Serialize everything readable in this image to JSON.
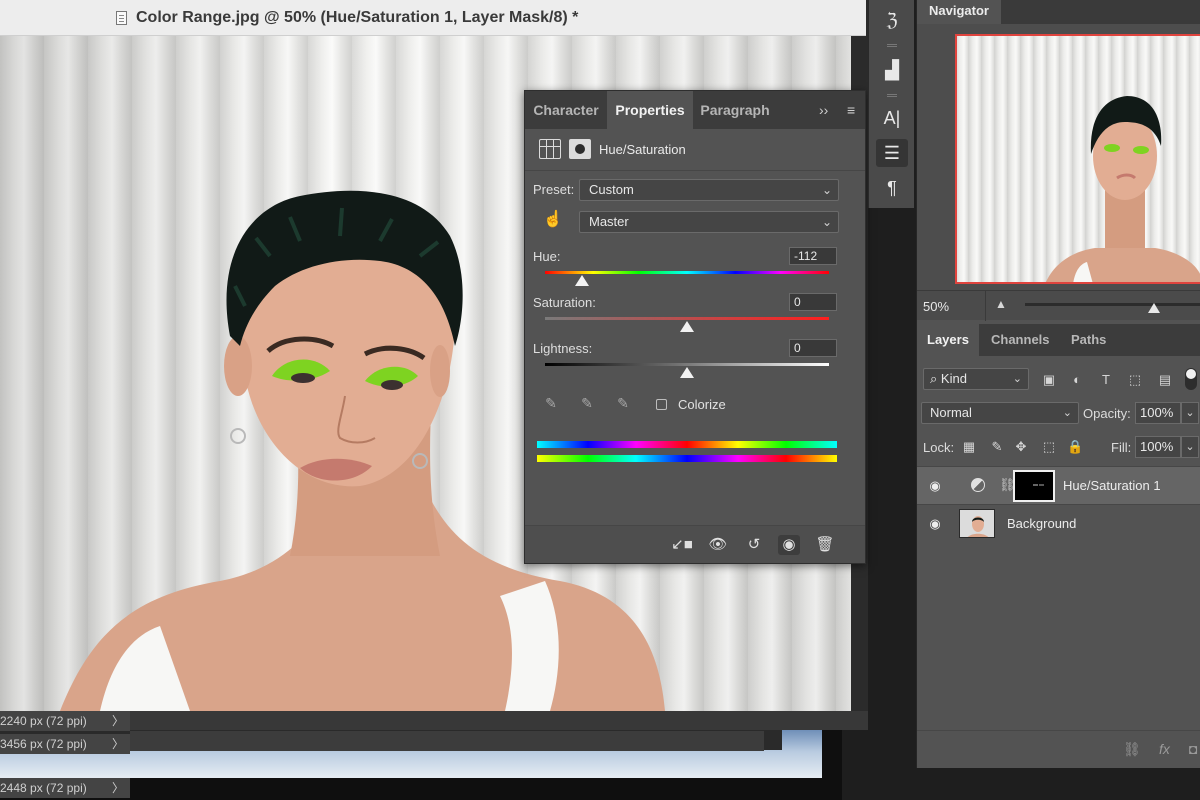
{
  "document": {
    "title": "Color Range.jpg @ 50% (Hue/Saturation 1, Layer Mask/8) *",
    "status_rows": [
      {
        "text": "2240 px (72 ppi)"
      },
      {
        "text": "3456 px (72 ppi)"
      },
      {
        "text": "2448 px (72 ppi)"
      }
    ]
  },
  "properties": {
    "tabs": [
      "Character",
      "Properties",
      "Paragraph"
    ],
    "active_tab": "Properties",
    "header_label": "Hue/Saturation",
    "preset_label": "Preset:",
    "preset_value": "Custom",
    "channel_value": "Master",
    "hue": {
      "label": "Hue:",
      "value": "-112",
      "position": 0.13
    },
    "saturation": {
      "label": "Saturation:",
      "value": "0",
      "position": 0.5
    },
    "lightness": {
      "label": "Lightness:",
      "value": "0",
      "position": 0.5
    },
    "colorize_label": "Colorize",
    "colorize_checked": false
  },
  "toolstrip": {
    "icons": [
      "history-brush-icon",
      "histogram-icon",
      "character-icon",
      "adjustments-icon",
      "paragraph-icon"
    ],
    "active": "adjustments-icon"
  },
  "navigator": {
    "tab": "Navigator",
    "zoom": "50%",
    "zoom_slider_position": 0.75
  },
  "layers": {
    "tabs": [
      "Layers",
      "Channels",
      "Paths"
    ],
    "active_tab": "Layers",
    "filter_kind": "Kind",
    "blend_mode": "Normal",
    "opacity_label": "Opacity:",
    "opacity": "100%",
    "lock_label": "Lock:",
    "fill_label": "Fill:",
    "fill": "100%",
    "items": [
      {
        "name": "Hue/Saturation 1",
        "visible": true,
        "selected": true
      },
      {
        "name": "Background",
        "visible": true,
        "selected": false
      }
    ]
  },
  "colors": {
    "accent_red": "#e0443e",
    "panel_bg": "#535353",
    "eyeshadow_green": "#7ed321"
  }
}
